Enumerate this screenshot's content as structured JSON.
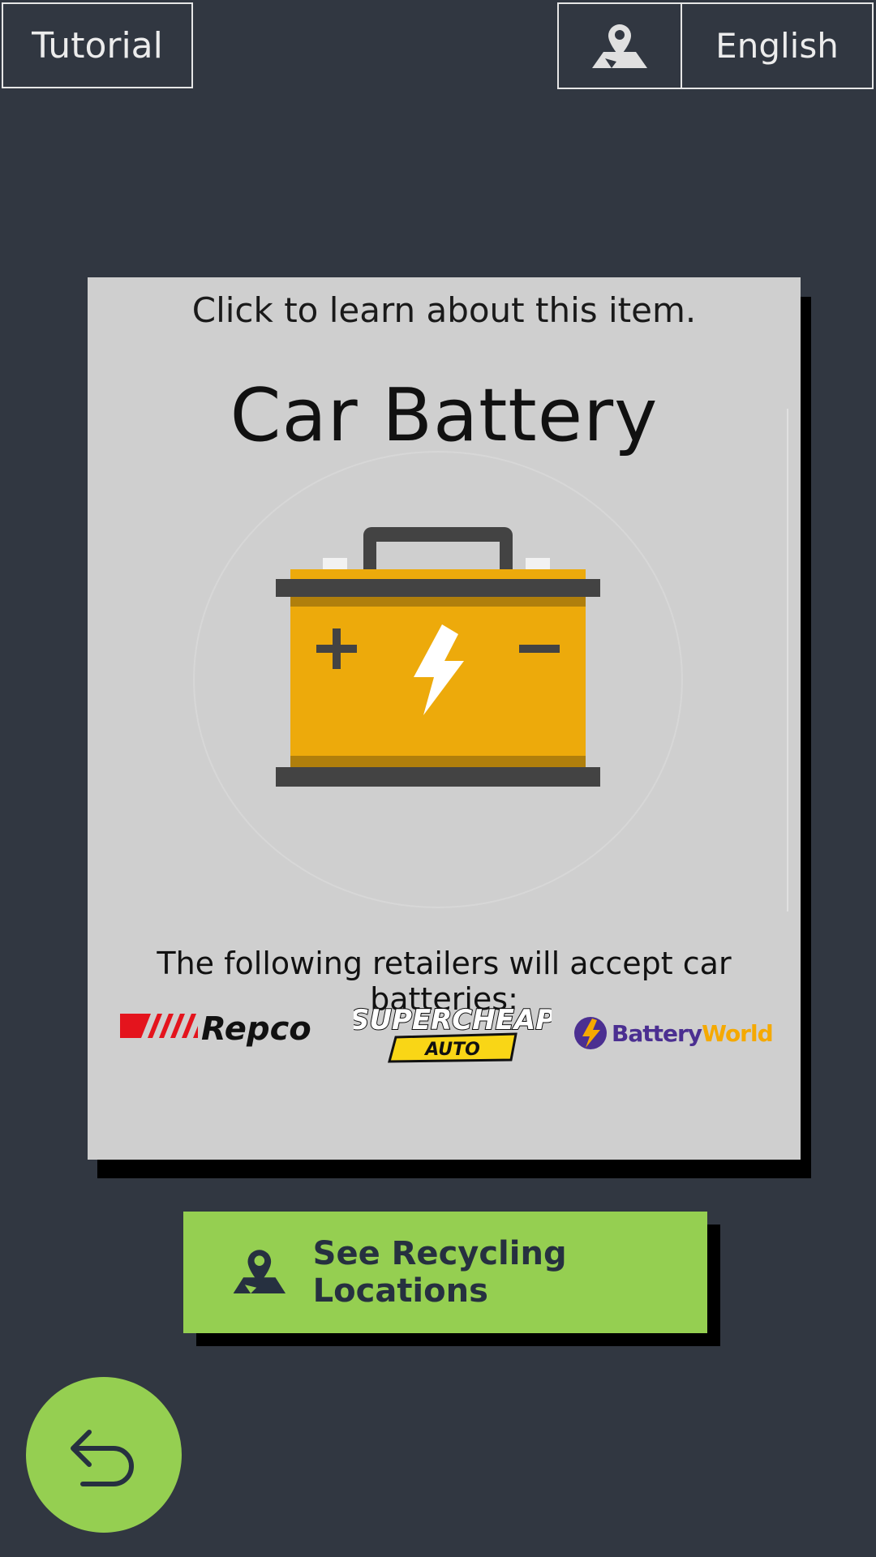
{
  "header": {
    "tutorial_label": "Tutorial",
    "language_label": "English",
    "map_icon": "map-pin-icon"
  },
  "card": {
    "hint": "Click to learn about this item.",
    "title": "Car Battery",
    "image_icon": "car-battery-icon",
    "retailers_text": "The following retailers will accept car batteries:",
    "retailers": [
      {
        "name": "Repco"
      },
      {
        "name_line1": "SUPERCHEAP",
        "name_line2": "AUTO"
      },
      {
        "name_part1": "Battery",
        "name_part2": "World"
      }
    ]
  },
  "cta": {
    "label": "See Recycling Locations",
    "icon": "map-pin-icon"
  },
  "back": {
    "icon": "back-arrow-icon"
  },
  "colors": {
    "background": "#313741",
    "card": "#cfcfcf",
    "accent_green": "#95cf51",
    "battery_yellow": "#edaa0b",
    "battery_dark": "#434343",
    "repco_red": "#e4141d",
    "supercheap_yellow": "#f9d616",
    "batteryworld_purple": "#4b2f91"
  }
}
